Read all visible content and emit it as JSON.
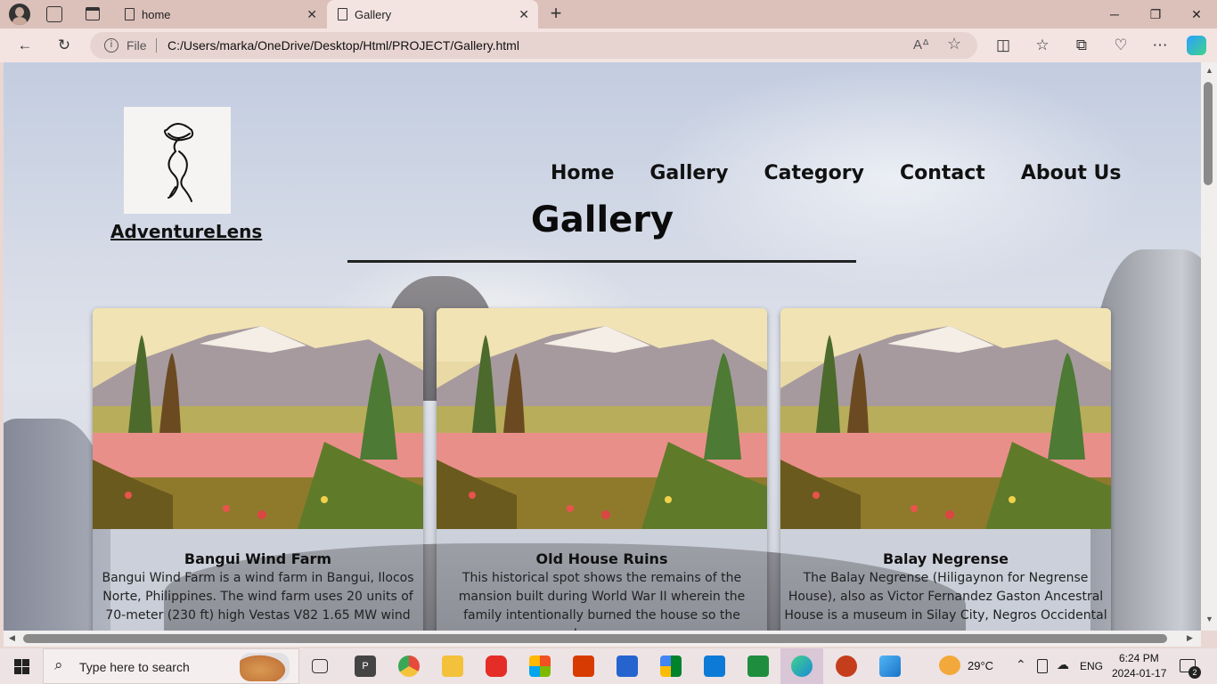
{
  "browser": {
    "tabs": [
      {
        "label": "home"
      },
      {
        "label": "Gallery"
      }
    ],
    "address": {
      "scheme_label": "File",
      "url": "C:/Users/marka/OneDrive/Desktop/Html/PROJECT/Gallery.html"
    }
  },
  "site": {
    "brand": "AdventureLens",
    "nav": [
      "Home",
      "Gallery",
      "Category",
      "Contact",
      "About Us"
    ],
    "page_title": "Gallery",
    "cards": [
      {
        "title": "Bangui Wind Farm",
        "text": "Bangui Wind Farm is a wind farm in Bangui, Ilocos Norte, Philippines. The wind farm uses 20 units of 70-meter (230 ft) high Vestas V82 1.65 MW wind"
      },
      {
        "title": "Old House Ruins",
        "text": "This historical spot shows the remains of the mansion built during World War II wherein the family intentionally burned the house so the Japanese"
      },
      {
        "title": "Balay Negrense",
        "text": "The Balay Negrense (Hiligaynon for Negrense House), also as Victor Fernandez Gaston Ancestral House is a museum in Silay City, Negros Occidental"
      }
    ]
  },
  "taskbar": {
    "search_placeholder": "Type here to search",
    "weather": "29°C",
    "language": "ENG",
    "time": "6:24 PM",
    "date": "2024-01-17",
    "notification_count": "2"
  }
}
